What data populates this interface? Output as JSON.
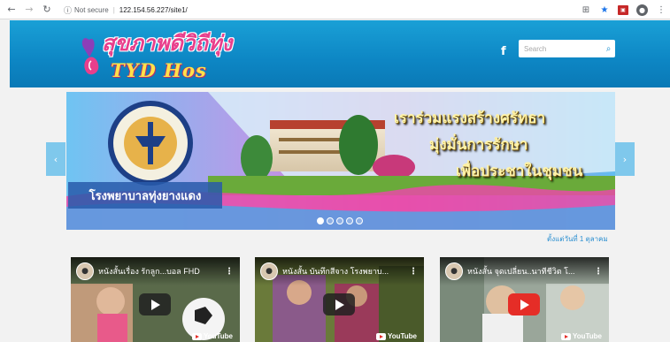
{
  "browser": {
    "security_label": "Not secure",
    "url": "122.154.56.227/site1/",
    "icons": [
      "back-icon",
      "forward-icon",
      "reload-icon",
      "info-icon",
      "translate-icon",
      "star-icon",
      "pdf-extension-icon",
      "profile-icon",
      "menu-icon"
    ]
  },
  "header": {
    "logo_thai": "สุขภาพดีวิถีทุ่ง",
    "logo_eng": "TYD Hos",
    "facebook_label": "f",
    "search_placeholder": "Search",
    "colors": {
      "header_top": "#1aa0d6",
      "header_bottom": "#0a79b6",
      "logo_pink": "#e83f8c",
      "logo_yellow": "#ffe14a"
    }
  },
  "slider": {
    "caption_lines": [
      "เราร่วมแรงสร้างศรัทธา",
      "มุ่งมั่นการรักษา",
      "เพื่อประชาในชุมชน"
    ],
    "hospital_label": "โรงพยาบาลทุ่งยางแดง",
    "dot_count": 5,
    "active_dot": 1,
    "prev_label": "‹",
    "next_label": "›",
    "established": "ตั้งแต่วันที่ 1 ตุลาคม"
  },
  "videos": [
    {
      "title": "หนังสั้นเรื่อง รักลูก...บอล FHD",
      "play_style": "dark",
      "yt_label": "YouTube"
    },
    {
      "title": "หนังสั้น บันทึกสีจาง โรงพยาบ...",
      "play_style": "dark",
      "yt_label": "YouTube"
    },
    {
      "title": "หนังสั้น จุดเปลี่ยน..นาทีชีวิต โ...",
      "play_style": "red",
      "yt_label": "YouTube"
    }
  ]
}
